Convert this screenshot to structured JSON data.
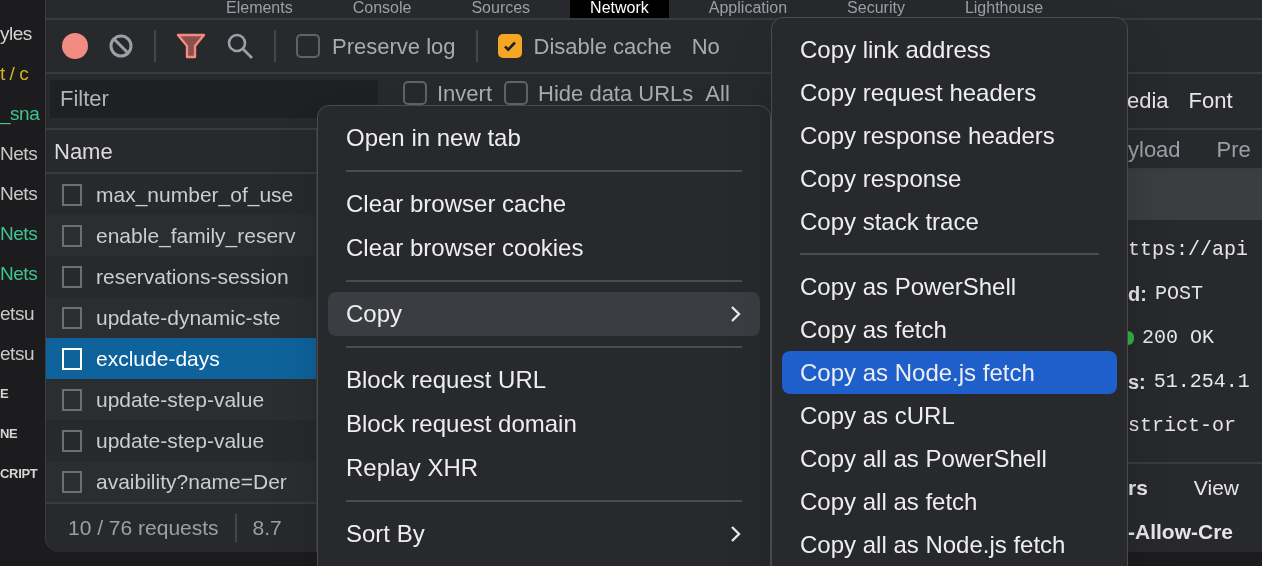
{
  "background_code": [
    {
      "text": "yles",
      "color": "#d4d4d4",
      "bold": false
    },
    {
      "text": "t / c",
      "color": "#d6b21e",
      "bold": false
    },
    {
      "text": "_sna",
      "color": "#3ec48d",
      "bold": false
    },
    {
      "text": "Nets",
      "color": "#c8c8c8",
      "bold": false
    },
    {
      "text": "Nets",
      "color": "#c8c8c8",
      "bold": false
    },
    {
      "text": "Nets",
      "color": "#3ec48d",
      "bold": false
    },
    {
      "text": "Nets",
      "color": "#3ec48d",
      "bold": false
    },
    {
      "text": "etsu",
      "color": "#c8c8c8",
      "bold": false
    },
    {
      "text": "etsu",
      "color": "#c8c8c8",
      "bold": false
    },
    {
      "text": "E",
      "color": "#d4d4d4",
      "bold": true
    },
    {
      "text": "NE",
      "color": "#d4d4d4",
      "bold": true
    },
    {
      "text": "CRIPT",
      "color": "#d4d4d4",
      "bold": true
    }
  ],
  "tabs": [
    {
      "label": "Elements",
      "selected": false
    },
    {
      "label": "Console",
      "selected": false
    },
    {
      "label": "Sources",
      "selected": false
    },
    {
      "label": "Network",
      "selected": true
    },
    {
      "label": "Application",
      "selected": false
    },
    {
      "label": "Security",
      "selected": false
    },
    {
      "label": "Lighthouse",
      "selected": false
    }
  ],
  "toolbar": {
    "recording": true,
    "filter_active": true,
    "preserve_log": {
      "label": "Preserve log",
      "checked": false
    },
    "disable_cache": {
      "label": "Disable cache",
      "checked": true
    },
    "throttling": "No"
  },
  "filter_bar": {
    "placeholder": "Filter",
    "options": [
      {
        "label": "Invert",
        "checked": false
      },
      {
        "label": "Hide data URLs",
        "checked": false
      }
    ],
    "type_all": "All"
  },
  "requests": {
    "column": "Name",
    "rows": [
      {
        "name": "max_number_of_use",
        "selected": false
      },
      {
        "name": "enable_family_reserv",
        "selected": false
      },
      {
        "name": "reservations-session",
        "selected": false
      },
      {
        "name": "update-dynamic-ste",
        "selected": false
      },
      {
        "name": "exclude-days",
        "selected": true
      },
      {
        "name": "update-step-value",
        "selected": false
      },
      {
        "name": "update-step-value",
        "selected": false
      },
      {
        "name": "avaibility?name=Der",
        "selected": false
      }
    ]
  },
  "status_bar": {
    "requests": "10 / 76 requests",
    "transferred": "8.7"
  },
  "details": {
    "type_filters": [
      "edia",
      "Font"
    ],
    "tabs": [
      "yload",
      "Pre"
    ],
    "general": [
      {
        "value": "ttps://api"
      },
      {
        "key": "d:",
        "value": "POST"
      },
      {
        "value": "200 OK",
        "color": "#2fb344"
      },
      {
        "key": "s:",
        "value": "51.254.1"
      },
      {
        "value": "strict-or"
      }
    ],
    "section": {
      "title": "rs",
      "action": "View"
    },
    "header": "-Allow-Cre"
  },
  "context_menu": {
    "items": [
      {
        "kind": "item",
        "label": "Open in new tab",
        "selected": false
      },
      {
        "kind": "separator"
      },
      {
        "kind": "item",
        "label": "Clear browser cache",
        "selected": false
      },
      {
        "kind": "item",
        "label": "Clear browser cookies",
        "selected": false
      },
      {
        "kind": "separator"
      },
      {
        "kind": "submenu",
        "label": "Copy",
        "selected": true
      },
      {
        "kind": "separator"
      },
      {
        "kind": "item",
        "label": "Block request URL",
        "selected": false
      },
      {
        "kind": "item",
        "label": "Block request domain",
        "selected": false
      },
      {
        "kind": "item",
        "label": "Replay XHR",
        "selected": false
      },
      {
        "kind": "separator"
      },
      {
        "kind": "submenu",
        "label": "Sort By",
        "selected": false
      }
    ]
  },
  "copy_submenu": {
    "items": [
      {
        "kind": "item",
        "label": "Copy link address",
        "selected": false
      },
      {
        "kind": "item",
        "label": "Copy request headers",
        "selected": false
      },
      {
        "kind": "item",
        "label": "Copy response headers",
        "selected": false
      },
      {
        "kind": "item",
        "label": "Copy response",
        "selected": false
      },
      {
        "kind": "item",
        "label": "Copy stack trace",
        "selected": false
      },
      {
        "kind": "separator"
      },
      {
        "kind": "item",
        "label": "Copy as PowerShell",
        "selected": false
      },
      {
        "kind": "item",
        "label": "Copy as fetch",
        "selected": false
      },
      {
        "kind": "item",
        "label": "Copy as Node.js fetch",
        "selected": true
      },
      {
        "kind": "item",
        "label": "Copy as cURL",
        "selected": false
      },
      {
        "kind": "item",
        "label": "Copy all as PowerShell",
        "selected": false
      },
      {
        "kind": "item",
        "label": "Copy all as fetch",
        "selected": false
      },
      {
        "kind": "item",
        "label": "Copy all as Node.js fetch",
        "selected": false
      }
    ]
  }
}
